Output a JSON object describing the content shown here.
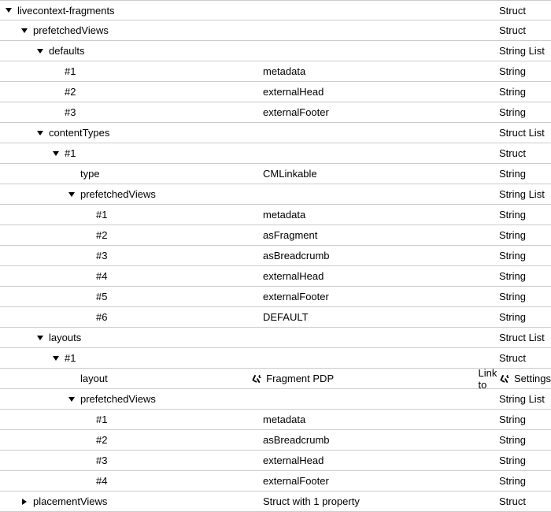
{
  "rows": [
    {
      "depth": 0,
      "toggle": "down",
      "name": "livecontext-fragments",
      "value": "",
      "type": "Struct"
    },
    {
      "depth": 1,
      "toggle": "down",
      "name": "prefetchedViews",
      "value": "",
      "type": "Struct"
    },
    {
      "depth": 2,
      "toggle": "down",
      "name": "defaults",
      "value": "",
      "type": "String List"
    },
    {
      "depth": 3,
      "toggle": null,
      "name": "#1",
      "value": "metadata",
      "type": "String"
    },
    {
      "depth": 3,
      "toggle": null,
      "name": "#2",
      "value": "externalHead",
      "type": "String"
    },
    {
      "depth": 3,
      "toggle": null,
      "name": "#3",
      "value": "externalFooter",
      "type": "String"
    },
    {
      "depth": 2,
      "toggle": "down",
      "name": "contentTypes",
      "value": "",
      "type": "Struct List"
    },
    {
      "depth": 3,
      "toggle": "down",
      "name": "#1",
      "value": "",
      "type": "Struct"
    },
    {
      "depth": 4,
      "toggle": null,
      "name": "type",
      "value": "CMLinkable",
      "type": "String"
    },
    {
      "depth": 4,
      "toggle": "down",
      "name": "prefetchedViews",
      "value": "",
      "type": "String List"
    },
    {
      "depth": 5,
      "toggle": null,
      "name": "#1",
      "value": "metadata",
      "type": "String"
    },
    {
      "depth": 5,
      "toggle": null,
      "name": "#2",
      "value": "asFragment",
      "type": "String"
    },
    {
      "depth": 5,
      "toggle": null,
      "name": "#3",
      "value": "asBreadcrumb",
      "type": "String"
    },
    {
      "depth": 5,
      "toggle": null,
      "name": "#4",
      "value": "externalHead",
      "type": "String"
    },
    {
      "depth": 5,
      "toggle": null,
      "name": "#5",
      "value": "externalFooter",
      "type": "String"
    },
    {
      "depth": 5,
      "toggle": null,
      "name": "#6",
      "value": "DEFAULT",
      "type": "String"
    },
    {
      "depth": 2,
      "toggle": "down",
      "name": "layouts",
      "value": "",
      "type": "Struct List"
    },
    {
      "depth": 3,
      "toggle": "down",
      "name": "#1",
      "value": "",
      "type": "Struct"
    },
    {
      "depth": 4,
      "toggle": null,
      "name": "layout",
      "value": "Fragment PDP",
      "valueIcon": "tools",
      "type": "Link to",
      "typeIcon": "tools",
      "typeSuffix": " Settings"
    },
    {
      "depth": 4,
      "toggle": "down",
      "name": "prefetchedViews",
      "value": "",
      "type": "String List"
    },
    {
      "depth": 5,
      "toggle": null,
      "name": "#1",
      "value": "metadata",
      "type": "String"
    },
    {
      "depth": 5,
      "toggle": null,
      "name": "#2",
      "value": "asBreadcrumb",
      "type": "String"
    },
    {
      "depth": 5,
      "toggle": null,
      "name": "#3",
      "value": "externalHead",
      "type": "String"
    },
    {
      "depth": 5,
      "toggle": null,
      "name": "#4",
      "value": "externalFooter",
      "type": "String"
    },
    {
      "depth": 1,
      "toggle": "right",
      "name": "placementViews",
      "value": "Struct with 1 property",
      "type": "Struct"
    }
  ]
}
